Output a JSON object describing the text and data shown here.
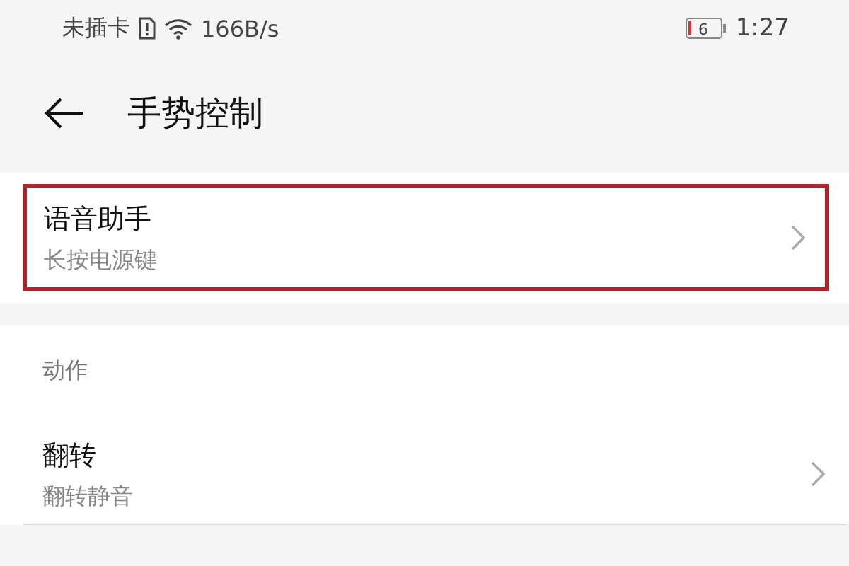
{
  "status_bar": {
    "carrier": "未插卡",
    "speed": "166B/s",
    "battery": "6",
    "time": "1:27"
  },
  "header": {
    "title": "手势控制"
  },
  "sections": [
    {
      "items": [
        {
          "title": "语音助手",
          "subtitle": "长按电源键",
          "highlighted": true
        }
      ]
    },
    {
      "heading": "动作",
      "items": [
        {
          "title": "翻转",
          "subtitle": "翻转静音",
          "highlighted": false
        }
      ]
    }
  ]
}
